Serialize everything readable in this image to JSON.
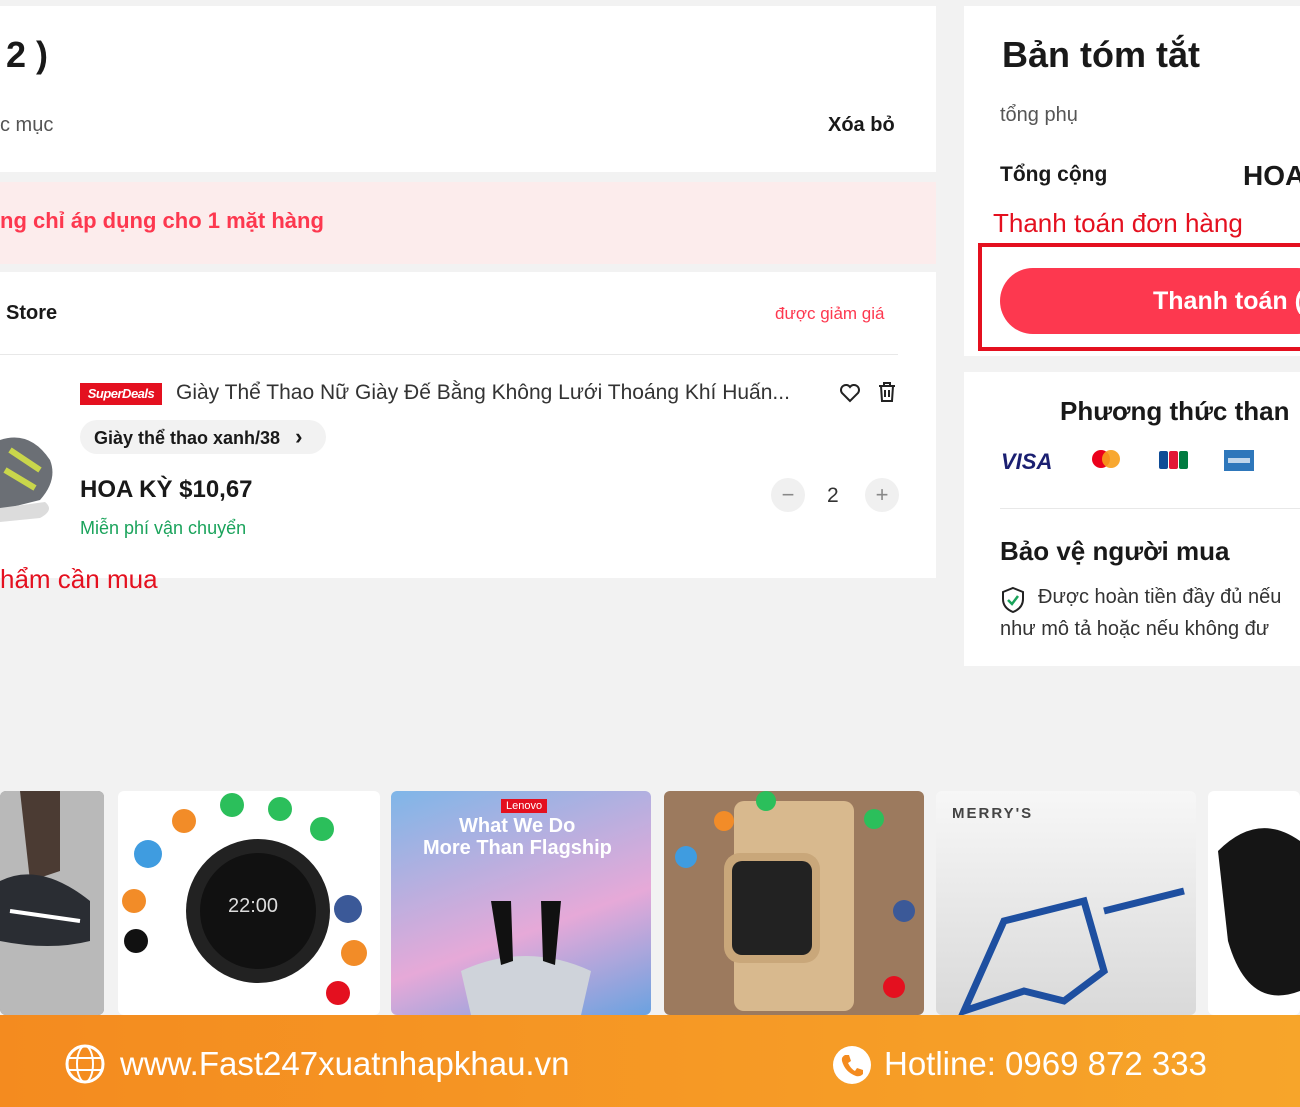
{
  "cart": {
    "heading": "2 )",
    "select_all_fragment": "c mục",
    "delete_label": "Xóa bỏ",
    "notice": "ng chỉ áp dụng cho 1 mặt hàng",
    "store_name": "Store",
    "store_discount": "được giảm giá",
    "item": {
      "badge": "SuperDeals",
      "title": "Giày Thể Thao Nữ Giày Đế Bằng Không Lưới Thoáng Khí Huấn...",
      "variant": "Giày thể thao xanh/38",
      "variant_chevron": "›",
      "price": "HOA KỲ $10,67",
      "shipping": "Miễn phí vận chuyển",
      "quantity": "2",
      "minus": "−",
      "plus": "+"
    },
    "annotation_products": "hẩm cần mua"
  },
  "summary": {
    "title": "Bản tóm tắt",
    "subtotal_label": "tổng phụ",
    "total_label": "Tổng cộng",
    "total_value_fragment": "HOA",
    "annotation_checkout": "Thanh toán đơn hàng",
    "checkout_button": "Thanh toán (",
    "payment_methods_title": "Phương thức than",
    "payment_logos": [
      "VISA",
      "mastercard",
      "JCB",
      "AMEX"
    ],
    "buyer_protection_title": "Bảo vệ người mua",
    "buyer_protection_line1": "Được hoàn tiền đầy đủ nếu",
    "buyer_protection_line2": "như mô tả hoặc nếu không đư"
  },
  "recommendations": {
    "promo_text_1": "What We Do",
    "promo_text_2": "More Than Flagship",
    "lenovo_badge": "Lenovo",
    "watch_time": "22:00",
    "glasses_brand": "MERRY'S"
  },
  "footer": {
    "website": "www.Fast247xuatnhapkhau.vn",
    "hotline": "Hotline: 0969 872 333"
  },
  "colors": {
    "accent_red": "#fd384f",
    "annotation_red": "#e4101f",
    "footer_orange": "#f48b1f",
    "shipping_green": "#1aa35b"
  }
}
